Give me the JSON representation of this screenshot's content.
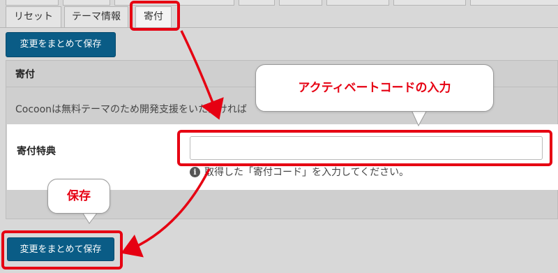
{
  "tabs": {
    "reset": "リセット",
    "theme_info": "テーマ情報",
    "donation": "寄付"
  },
  "toolbar": {
    "save_all_label": "変更をまとめて保存"
  },
  "panel": {
    "title": "寄付",
    "intro": "Cocoonは無料テーマのため開発支援をいただければ"
  },
  "form": {
    "label": "寄付特典",
    "input_value": "",
    "hint": "取得した「寄付コード」を入力してください。"
  },
  "annotations": {
    "activation_callout": "アクティベートコードの入力",
    "save_callout": "保存"
  },
  "colors": {
    "accent_red": "#e60012",
    "button_blue": "#0a5c86"
  }
}
